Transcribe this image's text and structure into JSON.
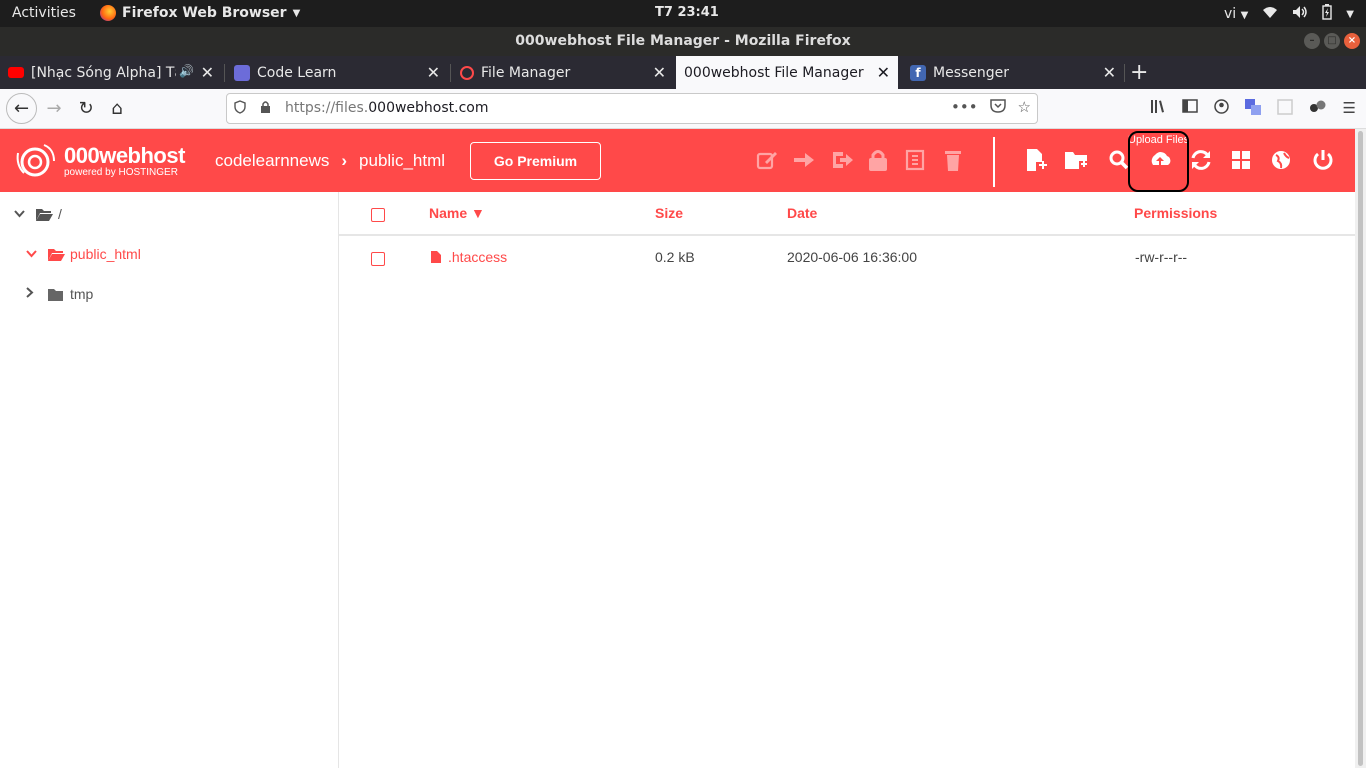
{
  "system": {
    "activities": "Activities",
    "app_name": "Firefox Web Browser",
    "clock": "T7 23:41",
    "lang": "vi"
  },
  "window": {
    "title": "000webhost File Manager - Mozilla Firefox"
  },
  "tabs": [
    {
      "label": "[Nhạc Sóng Alpha] Tăng",
      "favicon": "youtube-icon",
      "color": "#ff0000"
    },
    {
      "label": "Code Learn",
      "favicon": "codelearn-icon",
      "color": "#6c6cd9"
    },
    {
      "label": "File Manager",
      "favicon": "000webhost-icon",
      "color": "#ff4949"
    },
    {
      "label": "000webhost File Manager",
      "favicon": "none",
      "active": true
    },
    {
      "label": "Messenger",
      "favicon": "facebook-icon",
      "color": "#4267b2"
    }
  ],
  "address": {
    "prefix": "https://files.",
    "domain": "000webhost.com"
  },
  "app": {
    "brand": "000webhost",
    "powered": "powered by HOSTINGER",
    "breadcrumb": [
      "codelearnnews",
      "public_html"
    ],
    "premium_label": "Go Premium",
    "tooltip": "Upload Files",
    "accent": "#ff4949"
  },
  "tree": [
    {
      "label": "/",
      "level": 0,
      "expanded": true
    },
    {
      "label": "public_html",
      "level": 1,
      "expanded": true,
      "selected": true
    },
    {
      "label": "tmp",
      "level": 1,
      "expanded": false
    }
  ],
  "table": {
    "headers": {
      "name": "Name ▼",
      "size": "Size",
      "date": "Date",
      "permissions": "Permissions"
    },
    "rows": [
      {
        "name": ".htaccess",
        "size": "0.2 kB",
        "date": "2020-06-06 16:36:00",
        "permissions": "-rw-r--r--"
      }
    ]
  }
}
